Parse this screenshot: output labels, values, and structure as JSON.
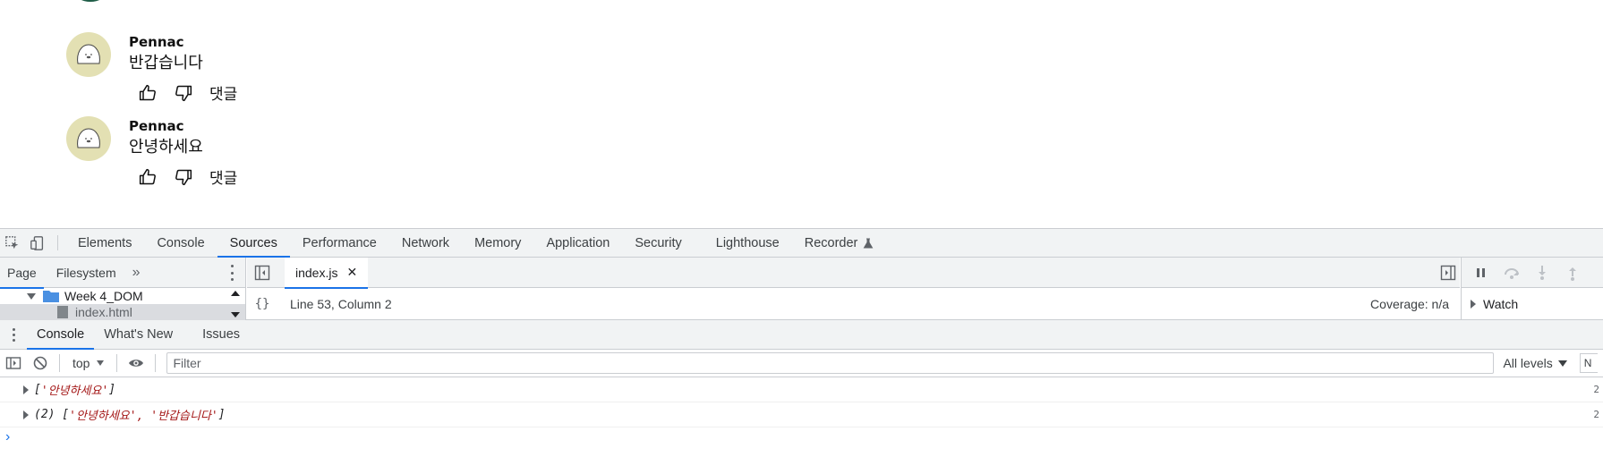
{
  "page": {
    "comments": [
      {
        "author": "Pennac",
        "text": "반갑습니다",
        "reply_label": "댓글"
      },
      {
        "author": "Pennac",
        "text": "안녕하세요",
        "reply_label": "댓글"
      }
    ]
  },
  "devtools": {
    "tabs": [
      "Elements",
      "Console",
      "Sources",
      "Performance",
      "Network",
      "Memory",
      "Application",
      "Security",
      "Lighthouse",
      "Recorder"
    ],
    "active_tab": "Sources",
    "navigator": {
      "tabs": [
        "Page",
        "Filesystem"
      ],
      "more": "»",
      "folder": "Week 4_DOM",
      "file": "index.html"
    },
    "editor": {
      "file_tab": "index.js",
      "close": "✕",
      "braces": "{}",
      "position": "Line 53, Column 2",
      "coverage": "Coverage: n/a"
    },
    "debugger": {
      "watch_label": "Watch"
    },
    "drawer": {
      "tabs": [
        "Console",
        "What's New",
        "Issues"
      ],
      "active_tab": "Console"
    },
    "console": {
      "context": "top",
      "filter_placeholder": "Filter",
      "levels": "All levels",
      "settings_edge": "N",
      "messages": [
        {
          "prefix": "[",
          "items": "'안녕하세요'",
          "suffix": "]",
          "src": "2"
        },
        {
          "prefix": "(2) [",
          "items": "'안녕하세요', '반갑습니다'",
          "suffix": "]",
          "src": "2"
        }
      ],
      "prompt": "›"
    }
  },
  "colors": {
    "accent": "#1a73e8",
    "toolbar_bg": "#f1f3f4",
    "avatar_bg": "#e3e0b3",
    "string": "#a31515"
  }
}
